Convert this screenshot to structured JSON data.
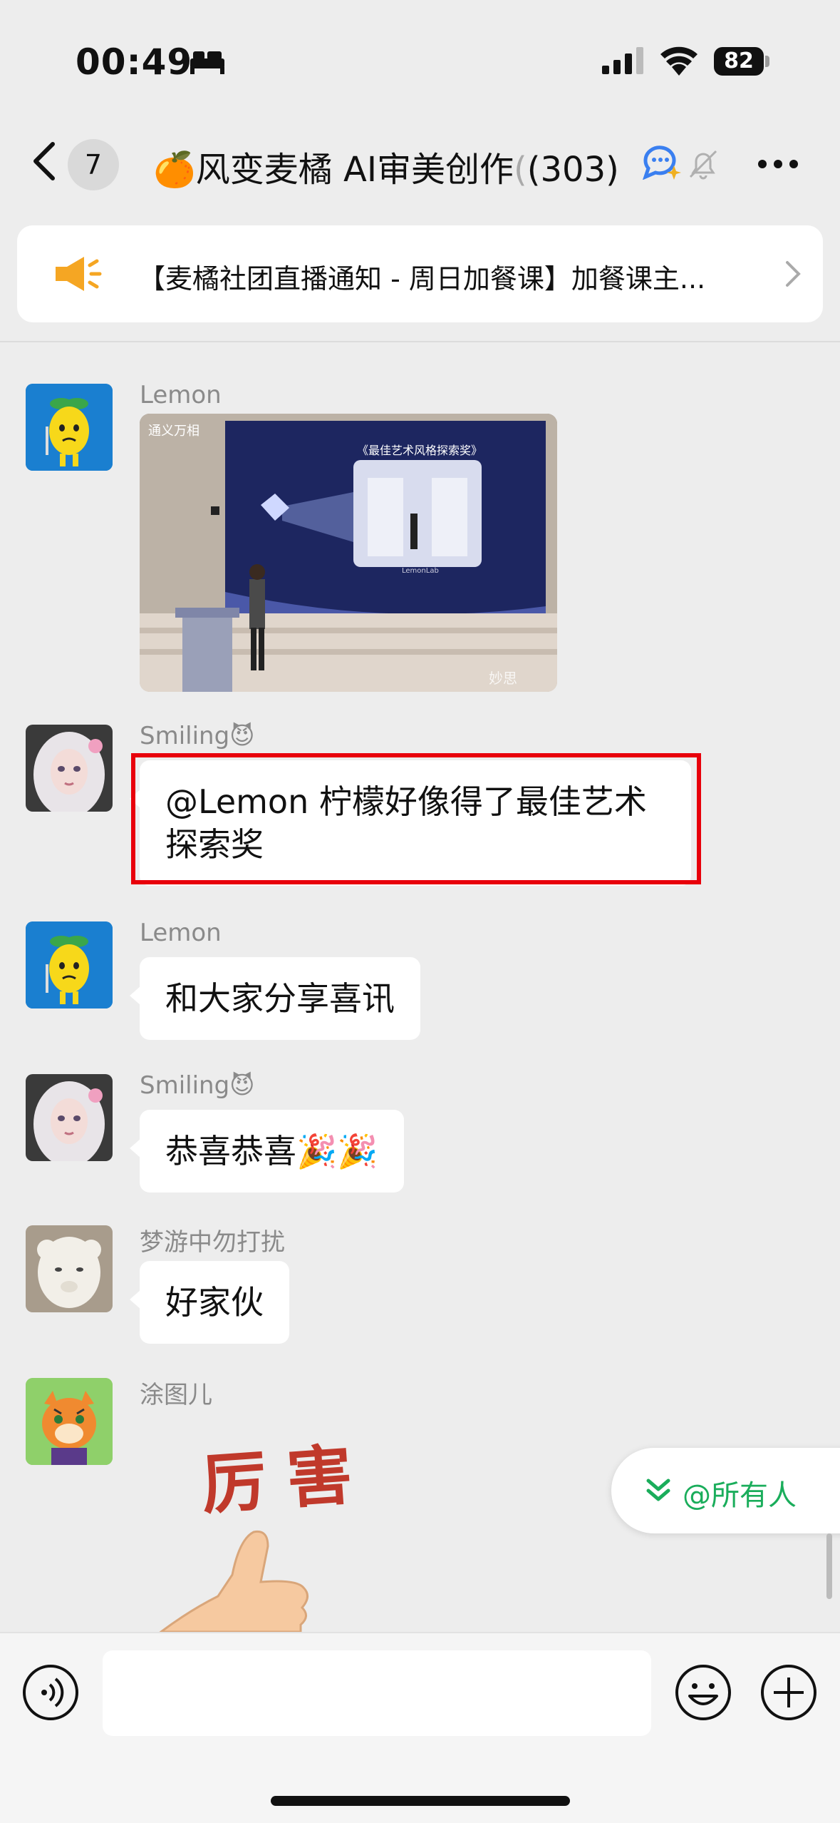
{
  "status_bar": {
    "time": "00:49",
    "battery": "82"
  },
  "header": {
    "back_count": "7",
    "title": "🍊风变麦橘 AI审美创作",
    "title_faded": "(",
    "member_count": "(303)"
  },
  "notice": {
    "text": "【麦橘社团直播通知 - 周日加餐课】加餐课主..."
  },
  "messages": [
    {
      "sender": "Lemon"
    },
    {
      "sender": "Smiling😈",
      "text": "@Lemon 柠檬好像得了最佳艺术探索奖"
    },
    {
      "sender": "Lemon",
      "text": "和大家分享喜讯"
    },
    {
      "sender": "Smiling😈",
      "text": "恭喜恭喜🎉🎉"
    },
    {
      "sender": "梦游中勿打扰",
      "text": "好家伙"
    },
    {
      "sender": "涂图儿",
      "sticker_text": "厉害"
    }
  ],
  "photo": {
    "screen_title": "《最佳艺术风格探索奖》",
    "logo_text": "通义万相",
    "caption": "LemonLab",
    "watermark": "妙思"
  },
  "at_all": {
    "label": "@所有人"
  },
  "colors": {
    "accent_green": "#1aad5b",
    "highlight_red": "#e8000b",
    "background": "#ededed"
  }
}
